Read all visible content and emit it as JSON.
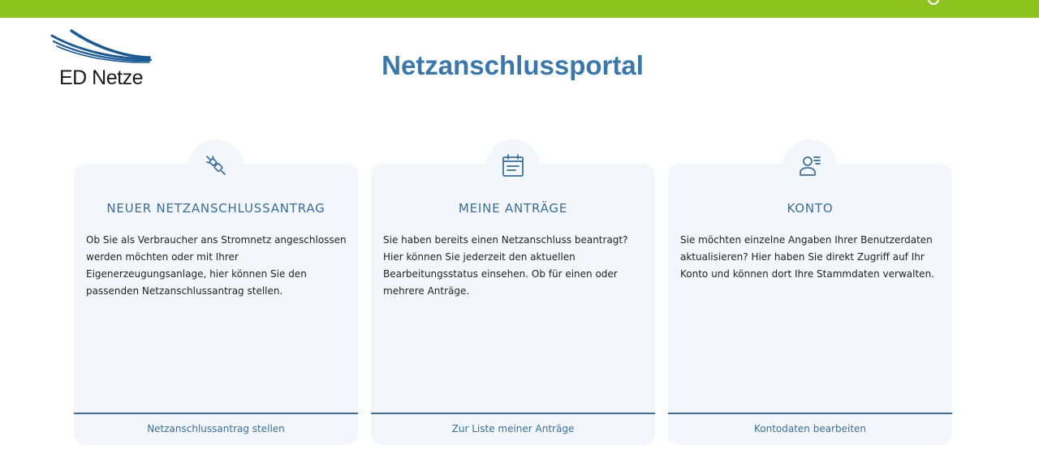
{
  "header": {
    "brand": "ED Netze",
    "title": "Netzanschlussportal",
    "accent_color": "#8dc21f",
    "title_color": "#3a77ab"
  },
  "cards": [
    {
      "icon": "plug-icon",
      "title": "NEUER NETZANSCHLUSSANTRAG",
      "text": "Ob Sie als Verbraucher ans Stromnetz angeschlossen werden möchten oder mit Ihrer Eigenerzeugungsanlage, hier können Sie den passenden Netzanschlussantrag stellen.",
      "link": "Netzanschlussantrag stellen"
    },
    {
      "icon": "calendar-icon",
      "title": "MEINE ANTRÄGE",
      "text": "Sie haben bereits einen Netzanschluss beantragt? Hier können Sie jederzeit den aktuellen Bearbeitungsstatus einsehen. Ob für einen oder mehrere Anträge.",
      "link": "Zur Liste meiner Anträge"
    },
    {
      "icon": "user-list-icon",
      "title": "KONTO",
      "text": "Sie möchten einzelne Angaben Ihrer Benutzerdaten aktualisieren? Hier haben Sie direkt Zugriff auf Ihr Konto und können dort Ihre Stammdaten verwalten.",
      "link": "Kontodaten bearbeiten"
    }
  ]
}
